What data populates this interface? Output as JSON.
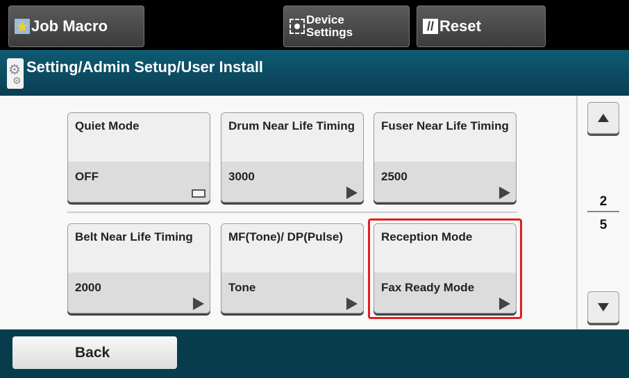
{
  "topbar": {
    "job_macro": "Job Macro",
    "device_settings_line1": "Device",
    "device_settings_line2": "Settings",
    "reset": "Reset"
  },
  "title": "Setting/Admin Setup/User Install",
  "tiles": [
    {
      "label": "Quiet Mode",
      "value": "OFF",
      "indicator": "toggle"
    },
    {
      "label": "Drum Near Life Timing",
      "value": "3000",
      "indicator": "arrow"
    },
    {
      "label": "Fuser Near Life Timing",
      "value": "2500",
      "indicator": "arrow"
    },
    {
      "label": "Belt Near Life Timing",
      "value": "2000",
      "indicator": "arrow"
    },
    {
      "label": "MF(Tone)/ DP(Pulse)",
      "value": "Tone",
      "indicator": "arrow"
    },
    {
      "label": "Reception Mode",
      "value": "Fax Ready Mode",
      "indicator": "arrow",
      "highlighted": true
    }
  ],
  "pager": {
    "current": "2",
    "total": "5"
  },
  "back": "Back",
  "colors": {
    "highlight": "#e02020",
    "titlebar": "#0f5b73",
    "bottombar": "#063c4c"
  }
}
